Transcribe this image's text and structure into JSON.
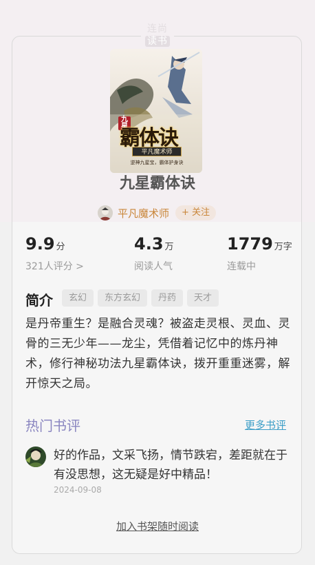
{
  "brand": {
    "line1": "连尚",
    "line2": "读书"
  },
  "book": {
    "title": "九星霸体诀",
    "cover": {
      "series": "九星",
      "title": "霸体诀",
      "author_banner": "平凡魔术师",
      "tagline": "逆神九星宝，霸体护身诀"
    }
  },
  "author": {
    "name": "平凡魔术师",
    "follow_label": "+ 关注"
  },
  "stats": {
    "rating": {
      "value": "9.9",
      "unit": "分",
      "label": "321人评分 >"
    },
    "readers": {
      "value": "4.3",
      "unit": "万",
      "label": "阅读人气"
    },
    "words": {
      "value": "1779",
      "unit": "万字",
      "label": "连载中"
    }
  },
  "intro": {
    "title": "简介",
    "tags": [
      "玄幻",
      "东方玄幻",
      "丹药",
      "天才"
    ],
    "text": "是丹帝重生？是融合灵魂？被盗走灵根、灵血、灵骨的三无少年——龙尘，凭借着记忆中的炼丹神术，修行神秘功法九星霸体诀，拨开重重迷雾，解开惊天之局。"
  },
  "reviews": {
    "title": "热门书评",
    "more_label": "更多书评",
    "items": [
      {
        "text": "好的作品，文采飞扬，情节跌宕，差距就在于有没思想，这无疑是好中精品！",
        "date": "2024-09-08"
      }
    ]
  },
  "actions": {
    "add_to_shelf": "加入书架随时阅读"
  },
  "colors": {
    "accent_author": "#c9863a",
    "review_title": "#8a86c0",
    "link": "#3c9ec7"
  }
}
